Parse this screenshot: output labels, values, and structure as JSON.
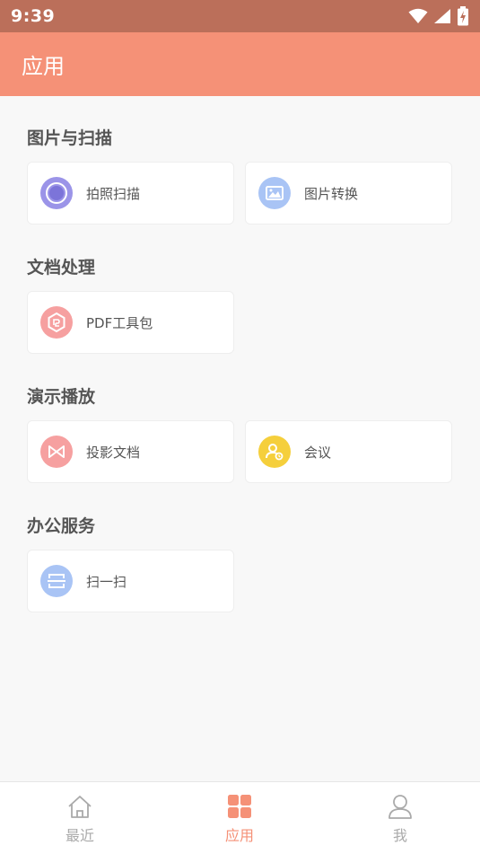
{
  "status_bar": {
    "time": "9:39",
    "icons": [
      "wifi-icon",
      "signal-icon",
      "battery-charging-icon"
    ]
  },
  "app_bar": {
    "title": "应用"
  },
  "sections": [
    {
      "title": "图片与扫描",
      "items": [
        {
          "label": "拍照扫描",
          "icon": "camera-scan-icon",
          "color": "#9b94e8"
        },
        {
          "label": "图片转换",
          "icon": "image-convert-icon",
          "color": "#a9c4f5"
        }
      ]
    },
    {
      "title": "文档处理",
      "items": [
        {
          "label": "PDF工具包",
          "icon": "pdf-toolkit-icon",
          "color": "#f6a0a0"
        }
      ]
    },
    {
      "title": "演示播放",
      "items": [
        {
          "label": "投影文档",
          "icon": "projection-icon",
          "color": "#f6a0a0"
        },
        {
          "label": "会议",
          "icon": "meeting-icon",
          "color": "#f5cf3c"
        }
      ]
    },
    {
      "title": "办公服务",
      "items": [
        {
          "label": "扫一扫",
          "icon": "qr-scan-icon",
          "color": "#a9c4f5"
        }
      ]
    }
  ],
  "bottom_nav": [
    {
      "label": "最近",
      "icon": "home-icon",
      "active": false
    },
    {
      "label": "应用",
      "icon": "apps-grid-icon",
      "active": true
    },
    {
      "label": "我",
      "icon": "profile-icon",
      "active": false
    }
  ],
  "colors": {
    "accent": "#f59177",
    "status_bar": "#bb6f5a",
    "inactive": "#aaaaaa"
  }
}
